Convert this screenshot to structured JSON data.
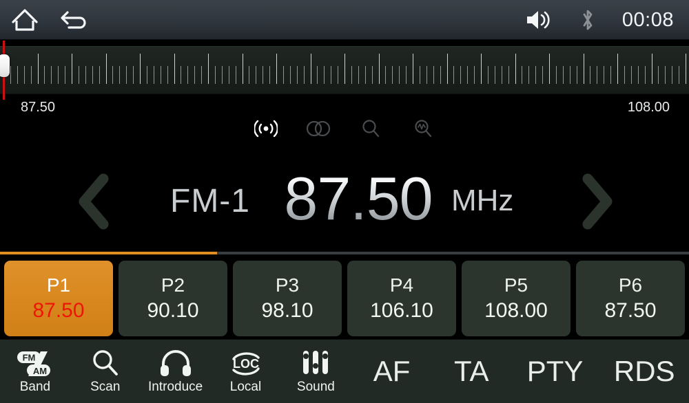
{
  "statusbar": {
    "home_icon": "home-icon",
    "back_icon": "back-arrow-icon",
    "volume_icon": "volume-icon",
    "bluetooth_icon": "bluetooth-icon",
    "clock": "00:08"
  },
  "tuner": {
    "scale_min_label": "87.50",
    "scale_max_label": "108.00",
    "needle_frequency": 87.5,
    "range_min": 87.5,
    "range_max": 108.0
  },
  "indicators": [
    {
      "name": "broadcast-icon",
      "label": "ST",
      "active": true
    },
    {
      "name": "stereo-icon",
      "label": "Stereo",
      "active": false
    },
    {
      "name": "search-icon",
      "label": "Search",
      "active": false
    },
    {
      "name": "search-wave-icon",
      "label": "Scan",
      "active": false
    }
  ],
  "display": {
    "prev_label": "prev-station",
    "next_label": "next-station",
    "band": "FM-1",
    "frequency": "87.50",
    "unit": "MHz"
  },
  "progress": {
    "percent": 31.5,
    "fill_color": "#e09020",
    "track_color": "#3a3d3f"
  },
  "presets": [
    {
      "num": "P1",
      "freq": "87.50",
      "active": true
    },
    {
      "num": "P2",
      "freq": "90.10",
      "active": false
    },
    {
      "num": "P3",
      "freq": "98.10",
      "active": false
    },
    {
      "num": "P4",
      "freq": "106.10",
      "active": false
    },
    {
      "num": "P5",
      "freq": "108.00",
      "active": false
    },
    {
      "num": "P6",
      "freq": "87.50",
      "active": false
    }
  ],
  "toolbar": {
    "band_label": "Band",
    "band_fm": "FM",
    "band_am": "AM",
    "scan_label": "Scan",
    "introduce_label": "Introduce",
    "local_label": "Local",
    "local_text": "LOC",
    "sound_label": "Sound",
    "af_label": "AF",
    "ta_label": "TA",
    "pty_label": "PTY",
    "rds_label": "RDS"
  },
  "theme": {
    "accent_orange": "#e09020",
    "active_red": "#ee1505",
    "preset_bg": "#2b352e",
    "toolbar_bg": "#222a25",
    "needle_red": "#cc1111"
  }
}
